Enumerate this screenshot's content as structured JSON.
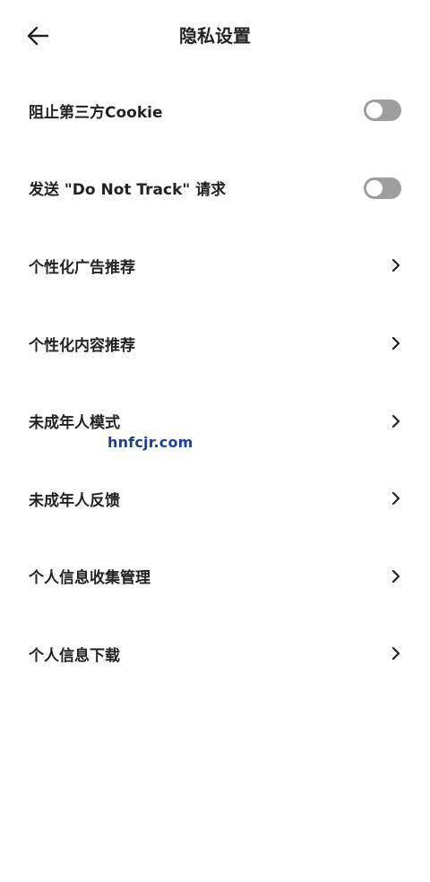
{
  "header": {
    "title": "隐私设置",
    "back_icon": "arrow-left-icon"
  },
  "settings": [
    {
      "label": "阻止第三方Cookie",
      "control": "toggle",
      "enabled": false
    },
    {
      "label": "发送 \"Do Not Track\" 请求",
      "control": "toggle",
      "enabled": false
    },
    {
      "label": "个性化广告推荐",
      "control": "chevron"
    },
    {
      "label": "个性化内容推荐",
      "control": "chevron"
    },
    {
      "label": "未成年人模式",
      "control": "chevron"
    },
    {
      "label": "未成年人反馈",
      "control": "chevron"
    },
    {
      "label": "个人信息收集管理",
      "control": "chevron"
    },
    {
      "label": "个人信息下载",
      "control": "chevron"
    }
  ],
  "watermark": "hnfcjr.com",
  "colors": {
    "toggle_off": "#9e9e9e",
    "text": "#222222",
    "watermark": "#1a3f9e"
  }
}
